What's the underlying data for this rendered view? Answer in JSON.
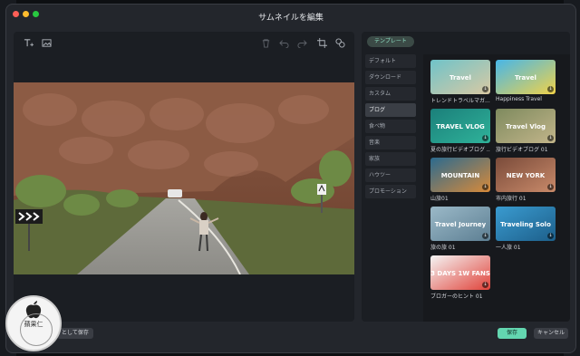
{
  "window": {
    "title": "サムネイルを編集"
  },
  "panel": {
    "tab_label": "テンプレート"
  },
  "categories": [
    {
      "label": "デフォルト",
      "active": false
    },
    {
      "label": "ダウンロード",
      "active": false
    },
    {
      "label": "カスタム",
      "active": false
    },
    {
      "label": "ブログ",
      "active": true
    },
    {
      "label": "食べ物",
      "active": false
    },
    {
      "label": "音楽",
      "active": false
    },
    {
      "label": "家族",
      "active": false
    },
    {
      "label": "ハウツー",
      "active": false
    },
    {
      "label": "プロモーション",
      "active": false
    }
  ],
  "templates": [
    {
      "caption": "トレンドトラベルマガ...",
      "art_text": "Travel",
      "colors": [
        "#6fc3c9",
        "#d9c9a3"
      ]
    },
    {
      "caption": "Happiness Travel",
      "art_text": "Travel",
      "colors": [
        "#47b6e8",
        "#f0d24a"
      ]
    },
    {
      "caption": "夏の旅行ビデオブログ ...",
      "art_text": "TRAVEL VLOG",
      "colors": [
        "#1b7f7a",
        "#2fb39a"
      ]
    },
    {
      "caption": "旅行ビデオブログ 01",
      "art_text": "Travel Vlog",
      "colors": [
        "#7e8a5e",
        "#c2b58a"
      ]
    },
    {
      "caption": "山旅01",
      "art_text": "MOUNTAIN",
      "colors": [
        "#2b6a8f",
        "#d88a3a"
      ]
    },
    {
      "caption": "市内旅行 01",
      "art_text": "NEW YORK",
      "colors": [
        "#7a4b3a",
        "#c98a6a"
      ]
    },
    {
      "caption": "旅の旅 01",
      "art_text": "Travel Journey",
      "colors": [
        "#9bb9c8",
        "#5d7f93"
      ]
    },
    {
      "caption": "一人旅 01",
      "art_text": "Traveling Solo",
      "colors": [
        "#3a9bd0",
        "#1d5f8a"
      ]
    },
    {
      "caption": "ブロガーのヒント 01",
      "art_text": "3 DAYS 1W FANS",
      "colors": [
        "#f5f5f5",
        "#e0433a"
      ]
    }
  ],
  "buttons": {
    "save_as_template": "として保存",
    "save": "保存",
    "cancel": "キャンセル"
  },
  "watermark": {
    "text": "蘋果仁"
  },
  "colors": {
    "accent": "#63d6b0",
    "window_bg": "#23262c",
    "panel_bg": "#1b1e23"
  }
}
